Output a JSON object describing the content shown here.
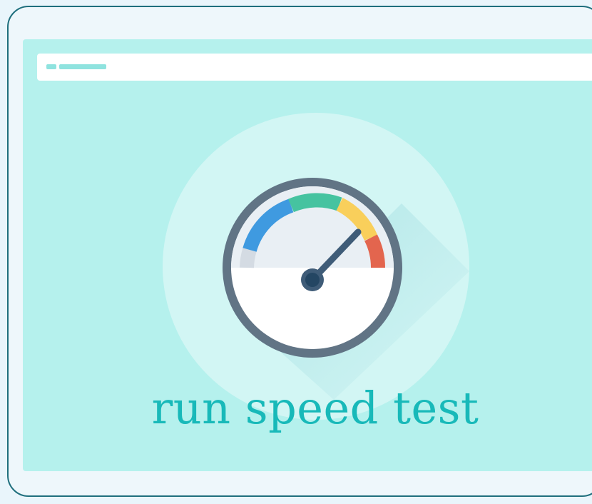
{
  "cta": {
    "label": "run speed test"
  },
  "colors": {
    "screen": "#b5f1ed",
    "halo": "#d2f6f4",
    "gauge_ring": "#617485",
    "gauge_face": "#e9eff4",
    "needle": "#3f5c78",
    "segment_gray": "#d4dbe3",
    "segment_blue": "#3f9ae0",
    "segment_green": "#46c3a0",
    "segment_yellow": "#f9cf5b",
    "segment_red": "#e3654e",
    "text": "#18b9b9"
  },
  "icons": {
    "gauge": "speedometer-icon",
    "address": "address-bar"
  }
}
